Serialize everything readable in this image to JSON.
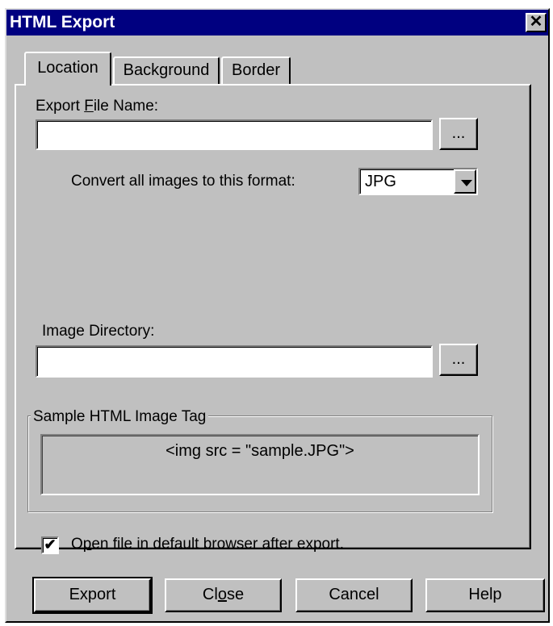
{
  "window": {
    "title": "HTML Export",
    "close_glyph": "✕"
  },
  "tabs": [
    {
      "label": "Location",
      "active": true
    },
    {
      "label": "Background",
      "active": false
    },
    {
      "label": "Border",
      "active": false
    }
  ],
  "export_file": {
    "label_prefix": "Export ",
    "label_accel": "F",
    "label_suffix": "ile Name:",
    "value": "",
    "browse_label": "..."
  },
  "format": {
    "label": "Convert all images to this format:",
    "selected": "JPG"
  },
  "image_dir": {
    "label": "Image Directory:",
    "value": "",
    "browse_label": "..."
  },
  "sample": {
    "legend": "Sample HTML Image Tag",
    "tag": "<img src = \"sample.JPG\">"
  },
  "open_browser": {
    "checked": true,
    "check_glyph": "✔",
    "label_prefix": "O",
    "label_accel": "p",
    "label_suffix": "en file in default browser after export."
  },
  "buttons": {
    "export": "Export",
    "close_prefix": "Cl",
    "close_accel": "o",
    "close_suffix": "se",
    "cancel": "Cancel",
    "help": "Help"
  },
  "colors": {
    "titlebar": "#000080",
    "face": "#c0c0c0"
  }
}
